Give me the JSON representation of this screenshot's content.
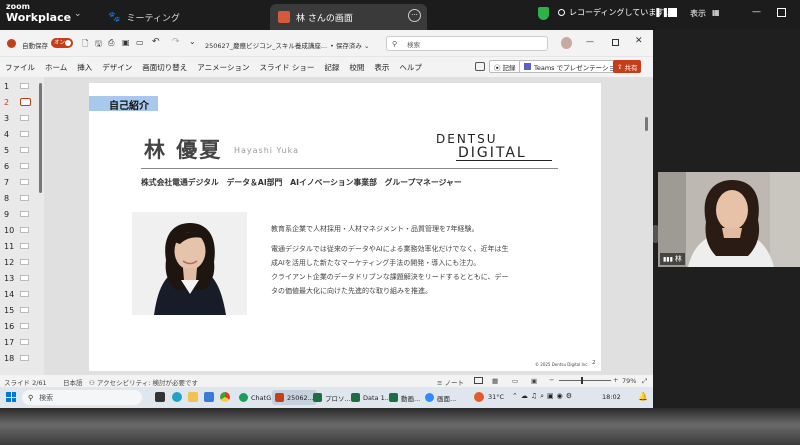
{
  "zoom": {
    "logo_top": "zoom",
    "logo_bottom": "Workplace",
    "tab_meeting": "ミーティング",
    "tab_screen": "林 さんの画面",
    "recording": "レコーディングしています...",
    "view": "表示",
    "participant_name": "林"
  },
  "ppt": {
    "autosave": "自動保存",
    "autosave_state": "オン",
    "filename": "250627_慶應ビジコン_スキル養成講座...",
    "save_state": "保存済み",
    "search_placeholder": "検索",
    "tabs": [
      "ファイル",
      "ホーム",
      "挿入",
      "デザイン",
      "画面切り替え",
      "アニメーション",
      "スライド ショー",
      "記録",
      "校閲",
      "表示",
      "ヘルプ"
    ],
    "record_button": "記録",
    "teams_button": "Teams でプレゼンテーション",
    "share_button": "共有",
    "thumb_numbers": [
      "1",
      "2",
      "3",
      "4",
      "5",
      "6",
      "7",
      "8",
      "9",
      "10",
      "11",
      "12",
      "13",
      "14",
      "15",
      "16",
      "17",
      "18"
    ],
    "status": {
      "slide": "スライド 2/61",
      "language": "日本語",
      "accessibility": "アクセシビリティ: 検討が必要です",
      "notes": "ノート",
      "zoom": "79%"
    }
  },
  "slide": {
    "section_label": "自己紹介",
    "name_jp": "林 優夏",
    "name_en": "Hayashi Yuka",
    "logo_line1": "DENTSU",
    "logo_line2": "DIGITAL",
    "affiliation": "株式会社電通デジタル　データ＆AI部門　AIイノベーション事業部　グループマネージャー",
    "bio_line1": "教育系企業で人材採用・人材マネジメント・品質管理を7年経験。",
    "bio_line2": "電通デジタルでは従来のデータやAIによる業務効率化だけでなく、近年は生",
    "bio_line3": "成AIを活用した新たなマーケティング手法の開発・導入にも注力。",
    "bio_line4": "クライアント企業のデータドリブンな課題解決をリードするとともに、デー",
    "bio_line5": "タの価値最大化に向けた先進的な取り組みを推進。",
    "copyright": "© 2025 Dentsu Digital Inc.",
    "page_number": "2"
  },
  "taskbar": {
    "search": "検索",
    "apps": [
      "ChatG...",
      "25062...",
      "プロソ...",
      "Data 1...",
      "動画...",
      "画面..."
    ],
    "weather": "31°C",
    "time": "18:02"
  }
}
